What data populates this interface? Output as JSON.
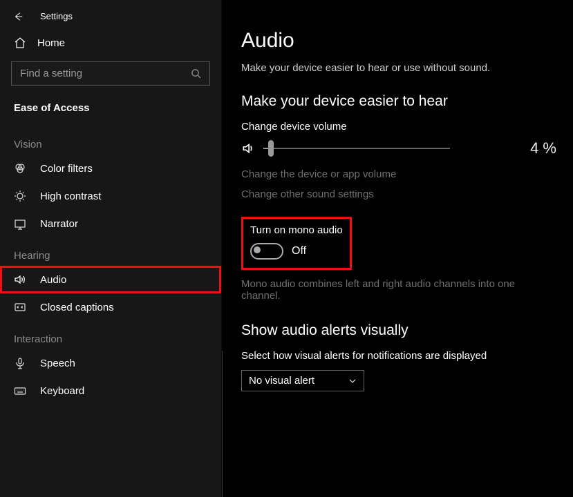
{
  "header": {
    "settings": "Settings"
  },
  "sidebar": {
    "home": "Home",
    "search_placeholder": "Find a setting",
    "category": "Ease of Access",
    "groups": [
      {
        "label": "Vision",
        "items": [
          {
            "id": "color-filters",
            "label": "Color filters"
          },
          {
            "id": "high-contrast",
            "label": "High contrast"
          },
          {
            "id": "narrator",
            "label": "Narrator"
          }
        ]
      },
      {
        "label": "Hearing",
        "items": [
          {
            "id": "audio",
            "label": "Audio",
            "selected": true
          },
          {
            "id": "closed-captions",
            "label": "Closed captions"
          }
        ]
      },
      {
        "label": "Interaction",
        "items": [
          {
            "id": "speech",
            "label": "Speech"
          },
          {
            "id": "keyboard",
            "label": "Keyboard"
          }
        ]
      }
    ]
  },
  "main": {
    "title": "Audio",
    "subtitle": "Make your device easier to hear or use without sound.",
    "hear_heading": "Make your device easier to hear",
    "volume_label": "Change device volume",
    "volume_percent": 4,
    "volume_display": "4 %",
    "link1": "Change the device or app volume",
    "link2": "Change other sound settings",
    "mono_heading": "Turn on mono audio",
    "mono_state": "Off",
    "mono_desc": "Mono audio combines left and right audio channels into one channel.",
    "visual_heading": "Show audio alerts visually",
    "visual_sub": "Select how visual alerts for notifications are displayed",
    "visual_selected": "No visual alert"
  }
}
